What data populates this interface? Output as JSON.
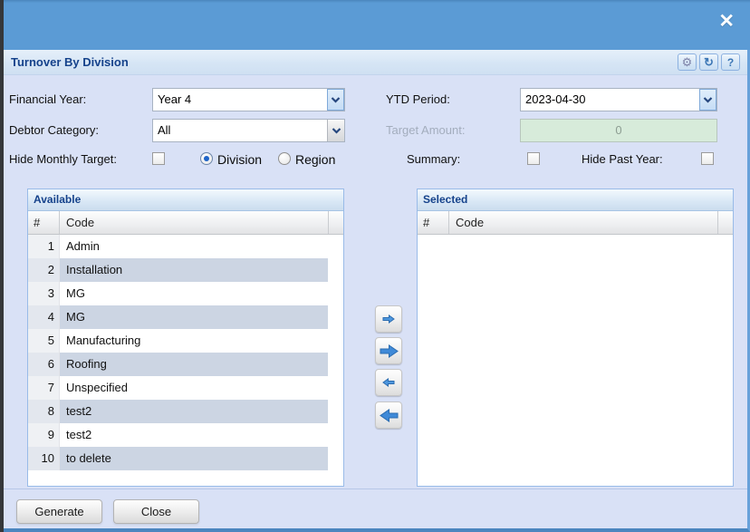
{
  "titlebar": {
    "title": "Turnover By Division"
  },
  "icons": {
    "close": "✕",
    "gear": "⚙",
    "refresh": "↻",
    "help": "?"
  },
  "form": {
    "financial_year": {
      "label": "Financial Year:",
      "value": "Year 4"
    },
    "debtor_category": {
      "label": "Debtor Category:",
      "value": "All"
    },
    "hide_monthly_target": {
      "label": "Hide Monthly Target:",
      "checked": false
    },
    "division": {
      "label": "Division",
      "selected": true
    },
    "region": {
      "label": "Region",
      "selected": false
    },
    "ytd_period": {
      "label": "YTD Period:",
      "value": "2023-04-30"
    },
    "target_amount": {
      "label": "Target Amount:",
      "value": "0",
      "disabled": true
    },
    "summary": {
      "label": "Summary:",
      "checked": false
    },
    "hide_past_year": {
      "label": "Hide Past Year:",
      "checked": false
    }
  },
  "available": {
    "title": "Available",
    "columns": [
      "#",
      "Code"
    ],
    "rows": [
      {
        "num": "1",
        "code": "Admin"
      },
      {
        "num": "2",
        "code": "Installation"
      },
      {
        "num": "3",
        "code": "MG"
      },
      {
        "num": "4",
        "code": "MG"
      },
      {
        "num": "5",
        "code": "Manufacturing"
      },
      {
        "num": "6",
        "code": "Roofing"
      },
      {
        "num": "7",
        "code": "Unspecified"
      },
      {
        "num": "8",
        "code": "test2"
      },
      {
        "num": "9",
        "code": "test2"
      },
      {
        "num": "10",
        "code": "to delete"
      }
    ]
  },
  "selected": {
    "title": "Selected",
    "columns": [
      "#",
      "Code"
    ],
    "rows": []
  },
  "footer": {
    "generate": "Generate",
    "close": "Close"
  },
  "colors": {
    "header_blue": "#5b9bd5",
    "title_text": "#15428b",
    "row_stripe": "#ccd5e3",
    "target_input_bg": "#d7ebda",
    "dialog_bg": "#d9e1f6"
  }
}
